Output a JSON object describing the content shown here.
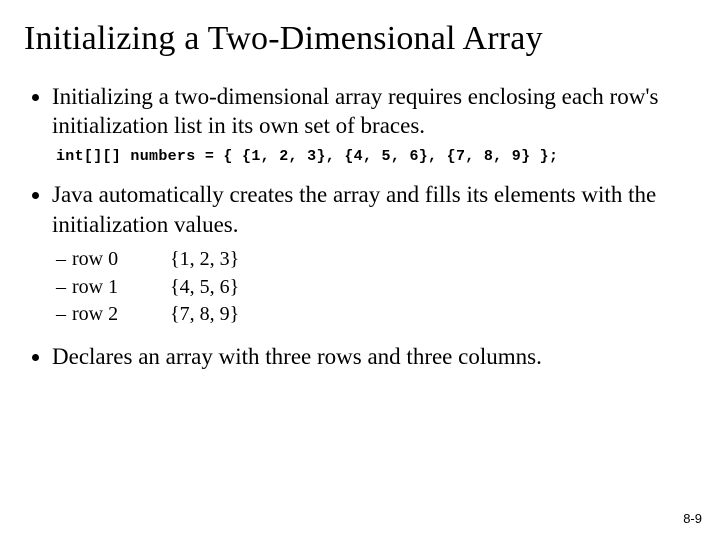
{
  "title": "Initializing a Two-Dimensional Array",
  "bullets": {
    "b1": "Initializing a two-dimensional array requires enclosing each row's initialization list in its own set of braces.",
    "code": "int[][] numbers = { {1, 2, 3}, {4, 5, 6}, {7, 8, 9} };",
    "b2": "Java automatically creates the array and fills its elements with the initialization values.",
    "b3": "Declares an array with three rows and three columns."
  },
  "rows": [
    {
      "label": "row 0",
      "value": "{1, 2, 3}"
    },
    {
      "label": "row 1",
      "value": "{4, 5, 6}"
    },
    {
      "label": "row 2",
      "value": "{7, 8, 9}"
    }
  ],
  "pagenum": "8-9"
}
